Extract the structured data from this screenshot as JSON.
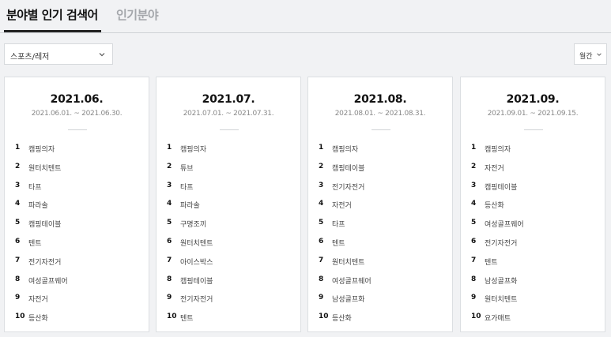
{
  "tabs": [
    {
      "label": "분야별 인기 검색어",
      "active": true
    },
    {
      "label": "인기분야",
      "active": false
    }
  ],
  "filters": {
    "category": "스포츠/레저",
    "period": "월간"
  },
  "cards": [
    {
      "month": "2021.06.",
      "range": "2021.06.01. ~ 2021.06.30.",
      "ranks": [
        {
          "num": "1",
          "keyword": "캠핑의자"
        },
        {
          "num": "2",
          "keyword": "원터치텐트"
        },
        {
          "num": "3",
          "keyword": "타프"
        },
        {
          "num": "4",
          "keyword": "파라솔"
        },
        {
          "num": "5",
          "keyword": "캠핑테이블"
        },
        {
          "num": "6",
          "keyword": "텐트"
        },
        {
          "num": "7",
          "keyword": "전기자전거"
        },
        {
          "num": "8",
          "keyword": "여성골프웨어"
        },
        {
          "num": "9",
          "keyword": "자전거"
        },
        {
          "num": "10",
          "keyword": "등산화"
        }
      ]
    },
    {
      "month": "2021.07.",
      "range": "2021.07.01. ~ 2021.07.31.",
      "ranks": [
        {
          "num": "1",
          "keyword": "캠핑의자"
        },
        {
          "num": "2",
          "keyword": "튜브"
        },
        {
          "num": "3",
          "keyword": "타프"
        },
        {
          "num": "4",
          "keyword": "파라솔"
        },
        {
          "num": "5",
          "keyword": "구명조끼"
        },
        {
          "num": "6",
          "keyword": "원터치텐트"
        },
        {
          "num": "7",
          "keyword": "아이스박스"
        },
        {
          "num": "8",
          "keyword": "캠핑테이블"
        },
        {
          "num": "9",
          "keyword": "전기자전거"
        },
        {
          "num": "10",
          "keyword": "텐트"
        }
      ]
    },
    {
      "month": "2021.08.",
      "range": "2021.08.01. ~ 2021.08.31.",
      "ranks": [
        {
          "num": "1",
          "keyword": "캠핑의자"
        },
        {
          "num": "2",
          "keyword": "캠핑테이블"
        },
        {
          "num": "3",
          "keyword": "전기자전거"
        },
        {
          "num": "4",
          "keyword": "자전거"
        },
        {
          "num": "5",
          "keyword": "타프"
        },
        {
          "num": "6",
          "keyword": "텐트"
        },
        {
          "num": "7",
          "keyword": "원터치텐트"
        },
        {
          "num": "8",
          "keyword": "여성골프웨어"
        },
        {
          "num": "9",
          "keyword": "남성골프화"
        },
        {
          "num": "10",
          "keyword": "등산화"
        }
      ]
    },
    {
      "month": "2021.09.",
      "range": "2021.09.01. ~ 2021.09.15.",
      "ranks": [
        {
          "num": "1",
          "keyword": "캠핑의자"
        },
        {
          "num": "2",
          "keyword": "자전거"
        },
        {
          "num": "3",
          "keyword": "캠핑테이블"
        },
        {
          "num": "4",
          "keyword": "등산화"
        },
        {
          "num": "5",
          "keyword": "여성골프웨어"
        },
        {
          "num": "6",
          "keyword": "전기자전거"
        },
        {
          "num": "7",
          "keyword": "텐트"
        },
        {
          "num": "8",
          "keyword": "남성골프화"
        },
        {
          "num": "9",
          "keyword": "원터치텐트"
        },
        {
          "num": "10",
          "keyword": "요가매트"
        }
      ]
    }
  ]
}
